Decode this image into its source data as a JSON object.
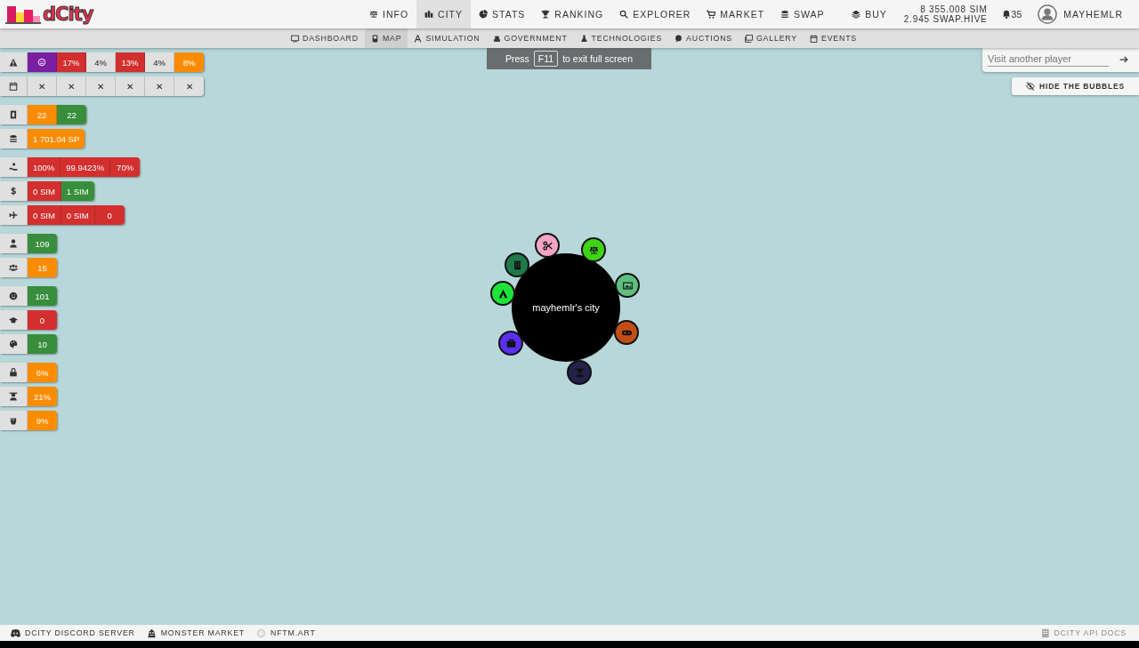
{
  "logo": {
    "text": "dCity"
  },
  "nav": [
    {
      "label": "INFO",
      "selected": false
    },
    {
      "label": "CITY",
      "selected": true
    },
    {
      "label": "STATS",
      "selected": false
    },
    {
      "label": "RANKING",
      "selected": false
    },
    {
      "label": "EXPLORER",
      "selected": false
    },
    {
      "label": "MARKET",
      "selected": false
    },
    {
      "label": "SWAP",
      "selected": false
    }
  ],
  "wallet": {
    "buy": "BUY",
    "balances": [
      "8 355.008 SIM",
      "2.945 SWAP.HIVE"
    ],
    "notifications": "35",
    "user": "MAYHEMLR"
  },
  "subnav": [
    {
      "label": "DASHBOARD",
      "selected": false
    },
    {
      "label": "MAP",
      "selected": true
    },
    {
      "label": "SIMULATION",
      "selected": false
    },
    {
      "label": "GOVERNMENT",
      "selected": false
    },
    {
      "label": "TECHNOLOGIES",
      "selected": false
    },
    {
      "label": "AUCTIONS",
      "selected": false
    },
    {
      "label": "GALLERY",
      "selected": false
    },
    {
      "label": "EVENTS",
      "selected": false
    }
  ],
  "fullscreen_notice": {
    "before": "Press",
    "key": "F11",
    "after": "to exit full screen"
  },
  "stats": [
    [
      {
        "cells": [
          {
            "kind": "icon",
            "color": "#7b1fa2"
          },
          {
            "kind": "text",
            "text": "17%",
            "color": "#d32f2f"
          },
          {
            "kind": "text",
            "text": "4%",
            "color": "#e0e0e0"
          },
          {
            "kind": "text",
            "text": "13%",
            "color": "#d32f2f"
          },
          {
            "kind": "text",
            "text": "4%",
            "color": "#e0e0e0"
          },
          {
            "kind": "text",
            "text": "8%",
            "color": "#fb8c00"
          }
        ]
      },
      {
        "cells": [
          {
            "kind": "text",
            "text": "✕",
            "color": "#e0e0e0"
          },
          {
            "kind": "text",
            "text": "✕",
            "color": "#e0e0e0"
          },
          {
            "kind": "text",
            "text": "✕",
            "color": "#e0e0e0"
          },
          {
            "kind": "text",
            "text": "✕",
            "color": "#e0e0e0"
          },
          {
            "kind": "text",
            "text": "✕",
            "color": "#e0e0e0"
          },
          {
            "kind": "text",
            "text": "✕",
            "color": "#e0e0e0"
          }
        ]
      }
    ],
    [
      {
        "cells": [
          {
            "kind": "text",
            "text": "22",
            "color": "#fb8c00"
          },
          {
            "kind": "text",
            "text": "22",
            "color": "#388e3c"
          }
        ]
      },
      {
        "cells": [
          {
            "kind": "text",
            "text": "1 701.04 SP",
            "color": "#fb8c00"
          }
        ]
      }
    ],
    [
      {
        "cells": [
          {
            "kind": "text",
            "text": "100%",
            "color": "#d32f2f"
          },
          {
            "kind": "text",
            "text": "99.9423%",
            "color": "#d32f2f"
          },
          {
            "kind": "text",
            "text": "70%",
            "color": "#d32f2f"
          }
        ]
      },
      {
        "cells": [
          {
            "kind": "text",
            "text": "0 SIM",
            "color": "#d32f2f"
          },
          {
            "kind": "text",
            "text": "1 SIM",
            "color": "#388e3c"
          }
        ]
      },
      {
        "cells": [
          {
            "kind": "text",
            "text": "0 SIM",
            "color": "#d32f2f"
          },
          {
            "kind": "text",
            "text": "0 SIM",
            "color": "#d32f2f"
          },
          {
            "kind": "text",
            "text": "0",
            "color": "#d32f2f"
          }
        ]
      }
    ],
    [
      {
        "cells": [
          {
            "kind": "text",
            "text": "109",
            "color": "#388e3c"
          }
        ]
      },
      {
        "cells": [
          {
            "kind": "text",
            "text": "15",
            "color": "#fb8c00"
          }
        ]
      }
    ],
    [
      {
        "cells": [
          {
            "kind": "text",
            "text": "101",
            "color": "#388e3c"
          }
        ]
      },
      {
        "cells": [
          {
            "kind": "text",
            "text": "0",
            "color": "#d32f2f"
          }
        ]
      },
      {
        "cells": [
          {
            "kind": "text",
            "text": "10",
            "color": "#388e3c"
          }
        ]
      }
    ],
    [
      {
        "cells": [
          {
            "kind": "text",
            "text": "6%",
            "color": "#fb8c00"
          }
        ]
      },
      {
        "cells": [
          {
            "kind": "text",
            "text": "21%",
            "color": "#fb8c00"
          }
        ]
      },
      {
        "cells": [
          {
            "kind": "text",
            "text": "9%",
            "color": "#fb8c00"
          }
        ]
      }
    ]
  ],
  "visit": {
    "placeholder": "Visit another player"
  },
  "hide_bubbles": "HIDE THE BUBBLES",
  "city": {
    "name": "mayhemlr's city",
    "bubbles": [
      {
        "color": "#f4a3c4"
      },
      {
        "color": "#3fd416"
      },
      {
        "color": "#5fbf7f"
      },
      {
        "color": "#c24e16"
      },
      {
        "color": "#22224a"
      },
      {
        "color": "#5a2ff0"
      },
      {
        "color": "#1ee43a"
      },
      {
        "color": "#1e7a4a"
      }
    ]
  },
  "footer": {
    "links": [
      {
        "label": "DCITY DISCORD SERVER",
        "disabled": false
      },
      {
        "label": "MONSTER MARKET",
        "disabled": false
      },
      {
        "label": "NFTM.ART",
        "disabled": false
      }
    ],
    "docs": {
      "label": "DCITY API DOCS",
      "disabled": true
    }
  }
}
